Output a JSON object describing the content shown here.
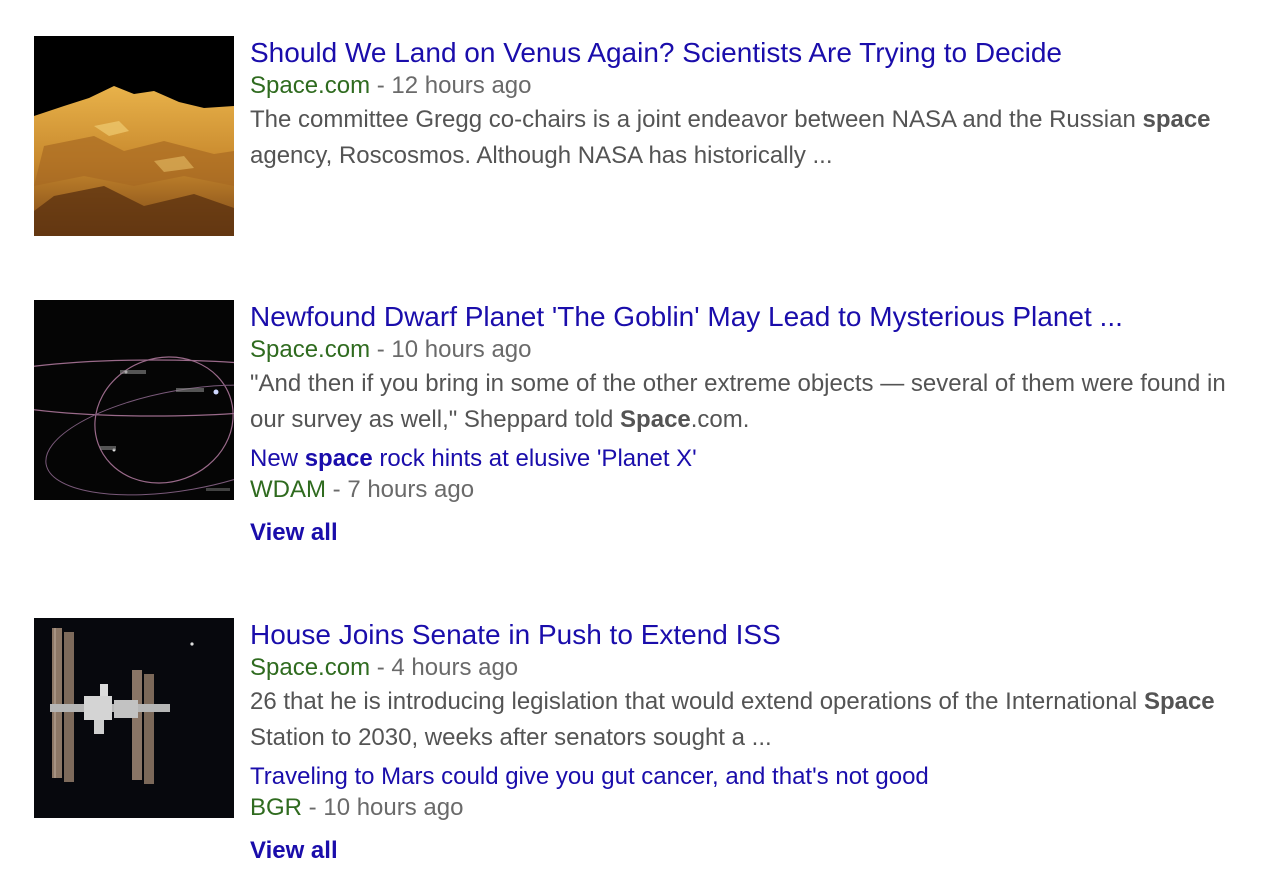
{
  "stories": [
    {
      "title": "Should We Land on Venus Again? Scientists Are Trying to Decide",
      "source": "Space.com",
      "separator": " - ",
      "time": "12 hours ago",
      "snippet_1": "The committee Gregg co-chairs is a joint endeavor between NASA and the Russian ",
      "snippet_2_bold": "space",
      "snippet_3": " agency, Roscosmos. Although NASA has historically ...",
      "image_icon": "venus-surface-image"
    },
    {
      "title": "Newfound Dwarf Planet 'The Goblin' May Lead to Mysterious Planet ...",
      "source": "Space.com",
      "separator": " - ",
      "time": "10 hours ago",
      "snippet_1": "\"And then if you bring in some of the other extreme objects — several of them were found in our survey as well,\" Sheppard told ",
      "snippet_2_bold": "Space",
      "snippet_3": ".com.",
      "related": {
        "link_1": "New ",
        "link_bold": "space",
        "link_2": " rock hints at elusive 'Planet X'",
        "source": "WDAM",
        "separator": " - ",
        "time": "7 hours ago"
      },
      "view_all": "View all",
      "image_icon": "orbit-diagram-image"
    },
    {
      "title": "House Joins Senate in Push to Extend ISS",
      "source": "Space.com",
      "separator": " - ",
      "time": "4 hours ago",
      "snippet_1": "26 that he is introducing legislation that would extend operations of the International ",
      "snippet_2_bold": "Space",
      "snippet_3": " Station to 2030, weeks after senators sought a ...",
      "related": {
        "link_1": "Traveling to Mars could give you gut cancer, and that's not good",
        "link_bold": "",
        "link_2": "",
        "source": "BGR",
        "separator": " - ",
        "time": "10 hours ago"
      },
      "view_all": "View all",
      "image_icon": "iss-image"
    }
  ],
  "colors": {
    "link": "#1a0dab",
    "source": "#2f6b1f",
    "meta": "#6a6a6a",
    "snippet": "#545454"
  }
}
